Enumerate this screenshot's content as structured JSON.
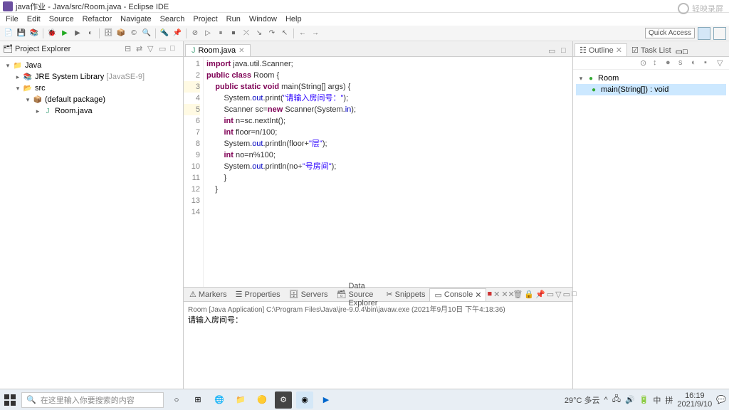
{
  "title": "java作业 - Java/src/Room.java - Eclipse IDE",
  "menu": [
    "File",
    "Edit",
    "Source",
    "Refactor",
    "Navigate",
    "Search",
    "Project",
    "Run",
    "Window",
    "Help"
  ],
  "quick_access": "Quick Access",
  "project_explorer": {
    "title": "Project Explorer",
    "tree": {
      "project": "Java",
      "jre": "JRE System Library",
      "jre_ver": "[JavaSE-9]",
      "src": "src",
      "pkg": "(default package)",
      "file": "Room.java"
    }
  },
  "editor": {
    "tab": "Room.java",
    "lines": [
      "1",
      "2",
      "3",
      "4",
      "5",
      "6",
      "7",
      "8",
      "9",
      "10",
      "11",
      "12",
      "13",
      "14"
    ],
    "code": {
      "l1_a": "import",
      "l1_b": " java.util.Scanner;",
      "l2_a": "public class",
      "l2_b": " Room {",
      "l3_a": "    public static void",
      "l3_b": " main(String[] args) {",
      "l4_a": "        System.",
      "l4_f": "out",
      "l4_b": ".print(",
      "l4_s": "\"请输入房间号：\"",
      "l4_c": ");",
      "l5_a": "        Scanner sc=",
      "l5_k": "new",
      "l5_b": " Scanner(System.",
      "l5_f": "in",
      "l5_c": ");",
      "l6_a": "        int",
      "l6_b": " n=sc.nextInt();",
      "l7_a": "        int",
      "l7_b": " floor=n/100;",
      "l8_a": "        System.",
      "l8_f": "out",
      "l8_b": ".println(floor+",
      "l8_s": "\"层\"",
      "l8_c": ");",
      "l9_a": "        int",
      "l9_b": " no=n%100;",
      "l10_a": "        System.",
      "l10_f": "out",
      "l10_b": ".println(no+",
      "l10_s": "\"号房间\"",
      "l10_c": ");",
      "l11": "        }",
      "l12": "",
      "l13": "    }",
      "l14": ""
    }
  },
  "outline": {
    "title": "Outline",
    "tasklist": "Task List",
    "root": "Room",
    "method": "main(String[]) : void"
  },
  "bottom_tabs": {
    "markers": "Markers",
    "properties": "Properties",
    "servers": "Servers",
    "dse": "Data Source Explorer",
    "snippets": "Snippets",
    "console": "Console"
  },
  "console": {
    "header": "Room [Java Application] C:\\Program Files\\Java\\jre-9.0.4\\bin\\javaw.exe (2021年9月10日 下午4:18:36)",
    "output": "请输入房间号："
  },
  "watermark": "轻映录屏",
  "taskbar": {
    "search_placeholder": "在这里输入你要搜索的内容",
    "weather": "29°C 多云",
    "time": "16:19",
    "date": "2021/9/10"
  }
}
